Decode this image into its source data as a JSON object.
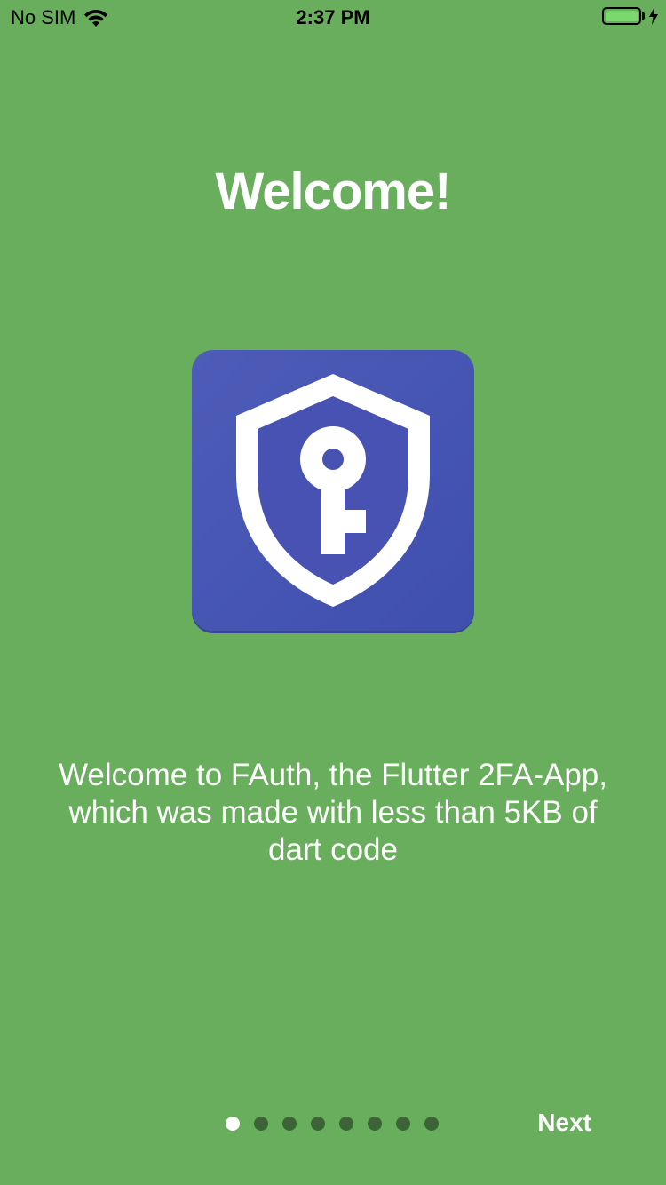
{
  "status_bar": {
    "carrier": "No SIM",
    "time": "2:37 PM",
    "battery_level": 1.0,
    "charging": true
  },
  "onboarding": {
    "title": "Welcome!",
    "description": "Welcome to FAuth, the Flutter 2FA-App, which was made with less than 5KB of dart code",
    "icon": "shield-key-icon",
    "page_count": 8,
    "current_page": 1,
    "next_label": "Next"
  },
  "colors": {
    "background": "#69ae5c",
    "icon_background": "#4653b3",
    "dot_active": "#ffffff",
    "dot_inactive": "#3c6436"
  }
}
